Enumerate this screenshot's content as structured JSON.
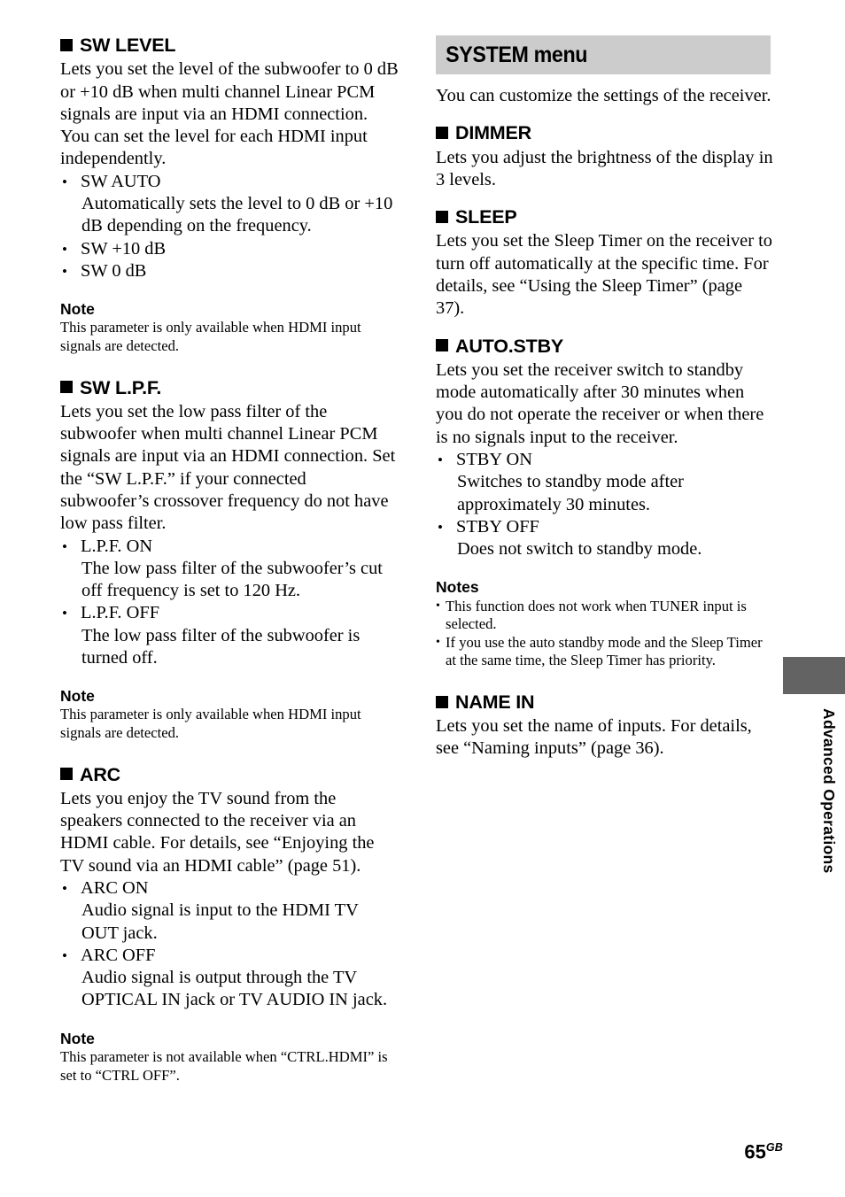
{
  "page": {
    "number": "65",
    "region_code": "GB",
    "side_tab_label": "Advanced Operations"
  },
  "left_column": {
    "sections": [
      {
        "id": "sw-level",
        "title": "SW LEVEL",
        "body": "Lets you set the level of the subwoofer to 0 dB or +10 dB when multi channel Linear PCM signals are input via an HDMI connection. You can set the level for each HDMI input independently.",
        "bullets": [
          {
            "label": "SW AUTO",
            "desc": "Automatically sets the level to 0 dB or +10 dB depending on the frequency."
          },
          {
            "label": "SW +10 dB",
            "desc": ""
          },
          {
            "label": "SW 0 dB",
            "desc": ""
          }
        ],
        "note": {
          "heading": "Note",
          "text": "This parameter is only available when HDMI input signals are detected."
        }
      },
      {
        "id": "sw-lpf",
        "title": "SW L.P.F.",
        "body": "Lets you set the low pass filter of the subwoofer when multi channel Linear PCM signals are input via an HDMI connection. Set the “SW L.P.F.” if your connected subwoofer’s crossover frequency do not have low pass filter.",
        "bullets": [
          {
            "label": "L.P.F. ON",
            "desc": "The low pass filter of the subwoofer’s cut off frequency is set to 120 Hz."
          },
          {
            "label": "L.P.F. OFF",
            "desc": "The low pass filter of the subwoofer is turned off."
          }
        ],
        "note": {
          "heading": "Note",
          "text": "This parameter is only available when HDMI input signals are detected."
        }
      },
      {
        "id": "arc",
        "title": "ARC",
        "body": "Lets you enjoy the TV sound from the speakers connected to the receiver via an HDMI cable. For details, see “Enjoying the TV sound via an HDMI cable” (page 51).",
        "bullets": [
          {
            "label": "ARC ON",
            "desc": "Audio signal is input to the HDMI TV OUT jack."
          },
          {
            "label": "ARC OFF",
            "desc": "Audio signal is output through the TV OPTICAL IN jack or TV AUDIO IN jack."
          }
        ],
        "note": {
          "heading": "Note",
          "text": "This parameter is not available when “CTRL.HDMI” is set to “CTRL OFF”."
        }
      }
    ]
  },
  "right_column": {
    "banner": "SYSTEM menu",
    "intro": "You can customize the settings of the receiver.",
    "sections": [
      {
        "id": "dimmer",
        "title": "DIMMER",
        "body": "Lets you adjust the brightness of the display in 3 levels."
      },
      {
        "id": "sleep",
        "title": "SLEEP",
        "body": "Lets you set the Sleep Timer on the receiver to turn off automatically at the specific time. For details, see “Using the Sleep Timer” (page 37)."
      },
      {
        "id": "auto-stby",
        "title": "AUTO.STBY",
        "body": "Lets you set the receiver switch to standby mode automatically after 30 minutes when you do not operate the receiver or when there is no signals input to the receiver.",
        "bullets": [
          {
            "label": "STBY ON",
            "desc": "Switches to standby mode after approximately 30 minutes."
          },
          {
            "label": "STBY OFF",
            "desc": "Does not switch to standby mode."
          }
        ],
        "notes": {
          "heading": "Notes",
          "items": [
            "This function does not work when TUNER input is selected.",
            "If you use the auto standby mode and the Sleep Timer at the same time, the Sleep Timer has priority."
          ]
        }
      },
      {
        "id": "name-in",
        "title": "NAME IN",
        "body": "Lets you set the name of inputs. For details, see “Naming inputs” (page 36)."
      }
    ]
  },
  "colors": {
    "banner_bg": "#cccccc",
    "tab_bg": "#636363",
    "text": "#000000",
    "page_bg": "#ffffff"
  }
}
